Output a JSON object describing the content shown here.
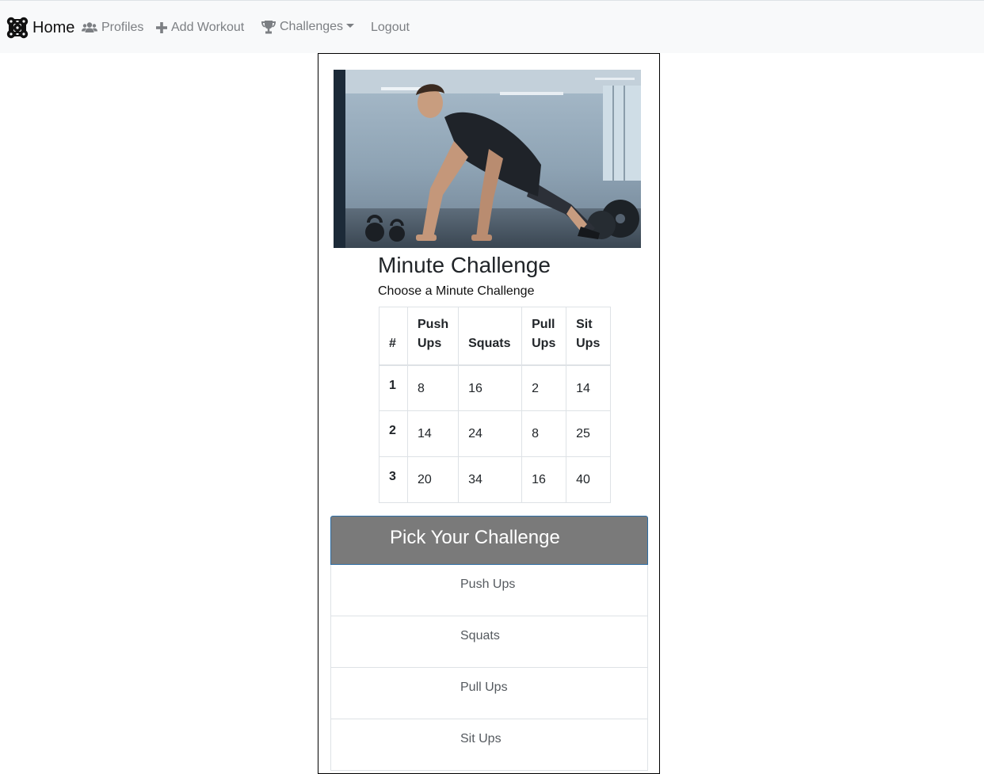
{
  "navbar": {
    "brand_label": "Home",
    "brand_icon": "dumbbell-cluster-logo-icon",
    "items": [
      {
        "label": "Profiles",
        "icon": "users-icon"
      },
      {
        "label": "Add Workout",
        "icon": "plus-icon"
      },
      {
        "label": "Challenges",
        "icon": "trophy-icon",
        "dropdown": true
      },
      {
        "label": "Logout"
      }
    ]
  },
  "card": {
    "image_alt": "Man doing push ups in a gym",
    "title": "Minute Challenge",
    "subtitle": "Choose a Minute Challenge"
  },
  "table": {
    "headers": [
      [
        "#"
      ],
      [
        "Push",
        "Ups"
      ],
      [
        "Squats"
      ],
      [
        "Pull",
        "Ups"
      ],
      [
        "Sit",
        "Ups"
      ]
    ],
    "rows": [
      {
        "num": "1",
        "push_ups": "8",
        "squats": "16",
        "pull_ups": "2",
        "sit_ups": "14"
      },
      {
        "num": "2",
        "push_ups": "14",
        "squats": "24",
        "pull_ups": "8",
        "sit_ups": "25"
      },
      {
        "num": "3",
        "push_ups": "20",
        "squats": "34",
        "pull_ups": "16",
        "sit_ups": "40"
      }
    ]
  },
  "pick_list": {
    "header": "Pick Your Challenge",
    "items": [
      "Push Ups",
      "Squats",
      "Pull Ups",
      "Sit Ups"
    ]
  },
  "colors": {
    "navbar_bg": "#f8f9fa",
    "nav_link": "#7c7f83",
    "list_header_bg": "#7a7a7a",
    "list_header_border": "#2e6da4"
  }
}
